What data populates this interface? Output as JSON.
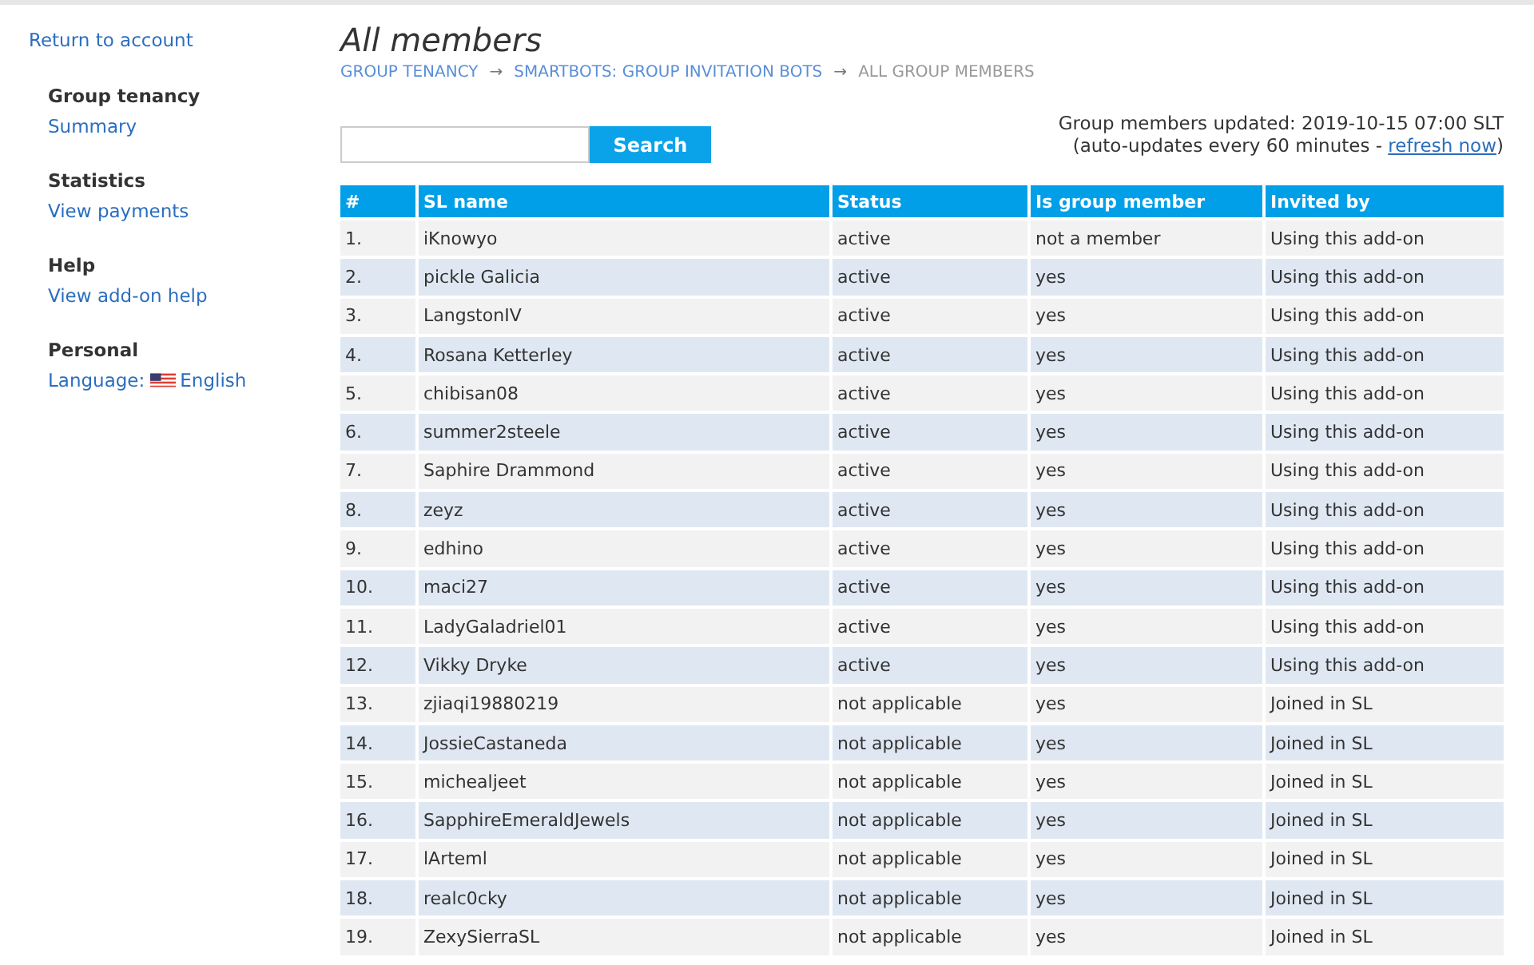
{
  "sidebar": {
    "back_link": "Return to account",
    "sections": [
      {
        "heading": "Group tenancy",
        "links": [
          {
            "label": "Summary"
          }
        ]
      },
      {
        "heading": "Statistics",
        "links": [
          {
            "label": "View payments"
          }
        ]
      },
      {
        "heading": "Help",
        "links": [
          {
            "label": "View add-on help"
          }
        ]
      },
      {
        "heading": "Personal",
        "links": [
          {
            "kind": "language",
            "label": "Language:",
            "value": "English"
          }
        ]
      }
    ]
  },
  "page": {
    "title": "All members",
    "breadcrumb": [
      {
        "label": "GROUP TENANCY",
        "link": true
      },
      {
        "label": "SMARTBOTS: GROUP INVITATION BOTS",
        "link": true
      },
      {
        "label": "ALL GROUP MEMBERS",
        "link": false
      }
    ],
    "breadcrumb_separator": "→"
  },
  "search": {
    "button": "Search"
  },
  "update_info": {
    "line1": "Group members updated: 2019-10-15 07:00 SLT",
    "line2_before": "(auto-updates every 60 minutes - ",
    "link": "refresh now",
    "line2_after": ")"
  },
  "table": {
    "columns": [
      "#",
      "SL name",
      "Status",
      "Is group member",
      "Invited by"
    ],
    "rows": [
      [
        "1.",
        "iKnowyo",
        "active",
        "not a member",
        "Using this add-on"
      ],
      [
        "2.",
        "pickle Galicia",
        "active",
        "yes",
        "Using this add-on"
      ],
      [
        "3.",
        "LangstonIV",
        "active",
        "yes",
        "Using this add-on"
      ],
      [
        "4.",
        "Rosana Ketterley",
        "active",
        "yes",
        "Using this add-on"
      ],
      [
        "5.",
        "chibisan08",
        "active",
        "yes",
        "Using this add-on"
      ],
      [
        "6.",
        "summer2steele",
        "active",
        "yes",
        "Using this add-on"
      ],
      [
        "7.",
        "Saphire Drammond",
        "active",
        "yes",
        "Using this add-on"
      ],
      [
        "8.",
        "zeyz",
        "active",
        "yes",
        "Using this add-on"
      ],
      [
        "9.",
        "edhino",
        "active",
        "yes",
        "Using this add-on"
      ],
      [
        "10.",
        "maci27",
        "active",
        "yes",
        "Using this add-on"
      ],
      [
        "11.",
        "LadyGaladriel01",
        "active",
        "yes",
        "Using this add-on"
      ],
      [
        "12.",
        "Vikky Dryke",
        "active",
        "yes",
        "Using this add-on"
      ],
      [
        "13.",
        "zjiaqi19880219",
        "not applicable",
        "yes",
        "Joined in SL"
      ],
      [
        "14.",
        "JossieCastaneda",
        "not applicable",
        "yes",
        "Joined in SL"
      ],
      [
        "15.",
        "michealjeet",
        "not applicable",
        "yes",
        "Joined in SL"
      ],
      [
        "16.",
        "SapphireEmeraldJewels",
        "not applicable",
        "yes",
        "Joined in SL"
      ],
      [
        "17.",
        "lArteml",
        "not applicable",
        "yes",
        "Joined in SL"
      ],
      [
        "18.",
        "realc0cky",
        "not applicable",
        "yes",
        "Joined in SL"
      ],
      [
        "19.",
        "ZexySierraSL",
        "not applicable",
        "yes",
        "Joined in SL"
      ]
    ]
  }
}
